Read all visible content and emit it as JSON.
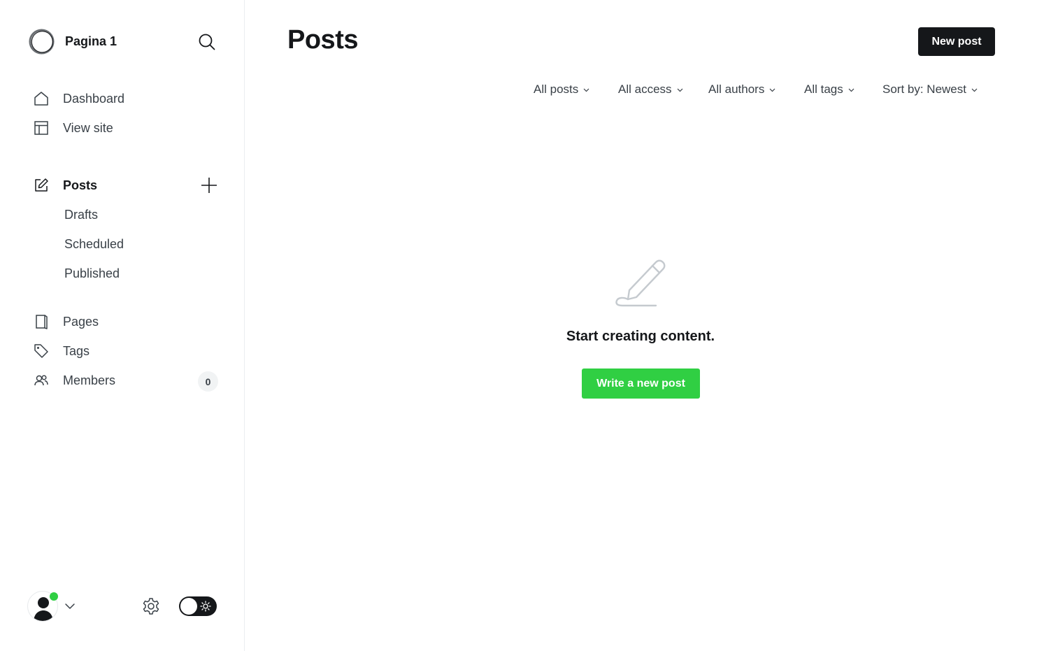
{
  "site": {
    "name": "Pagina 1"
  },
  "sidebar": {
    "nav_top": [
      {
        "label": "Dashboard",
        "icon": "home-icon"
      },
      {
        "label": "View site",
        "icon": "layout-icon"
      }
    ],
    "posts": {
      "label": "Posts",
      "icon": "edit-icon"
    },
    "posts_sub": [
      {
        "label": "Drafts"
      },
      {
        "label": "Scheduled"
      },
      {
        "label": "Published"
      }
    ],
    "nav_bottom": [
      {
        "label": "Pages",
        "icon": "page-icon"
      },
      {
        "label": "Tags",
        "icon": "tag-icon"
      },
      {
        "label": "Members",
        "icon": "members-icon",
        "count": "0"
      }
    ]
  },
  "main": {
    "title": "Posts",
    "new_post_label": "New post",
    "filters": [
      {
        "label": "All posts"
      },
      {
        "label": "All access"
      },
      {
        "label": "All authors"
      },
      {
        "label": "All tags"
      },
      {
        "label": "Sort by: Newest"
      }
    ],
    "empty_state": {
      "message": "Start creating content.",
      "button_label": "Write a new post"
    }
  },
  "colors": {
    "accent_green": "#30cf43",
    "dark": "#15171a",
    "text_secondary": "#394047"
  }
}
